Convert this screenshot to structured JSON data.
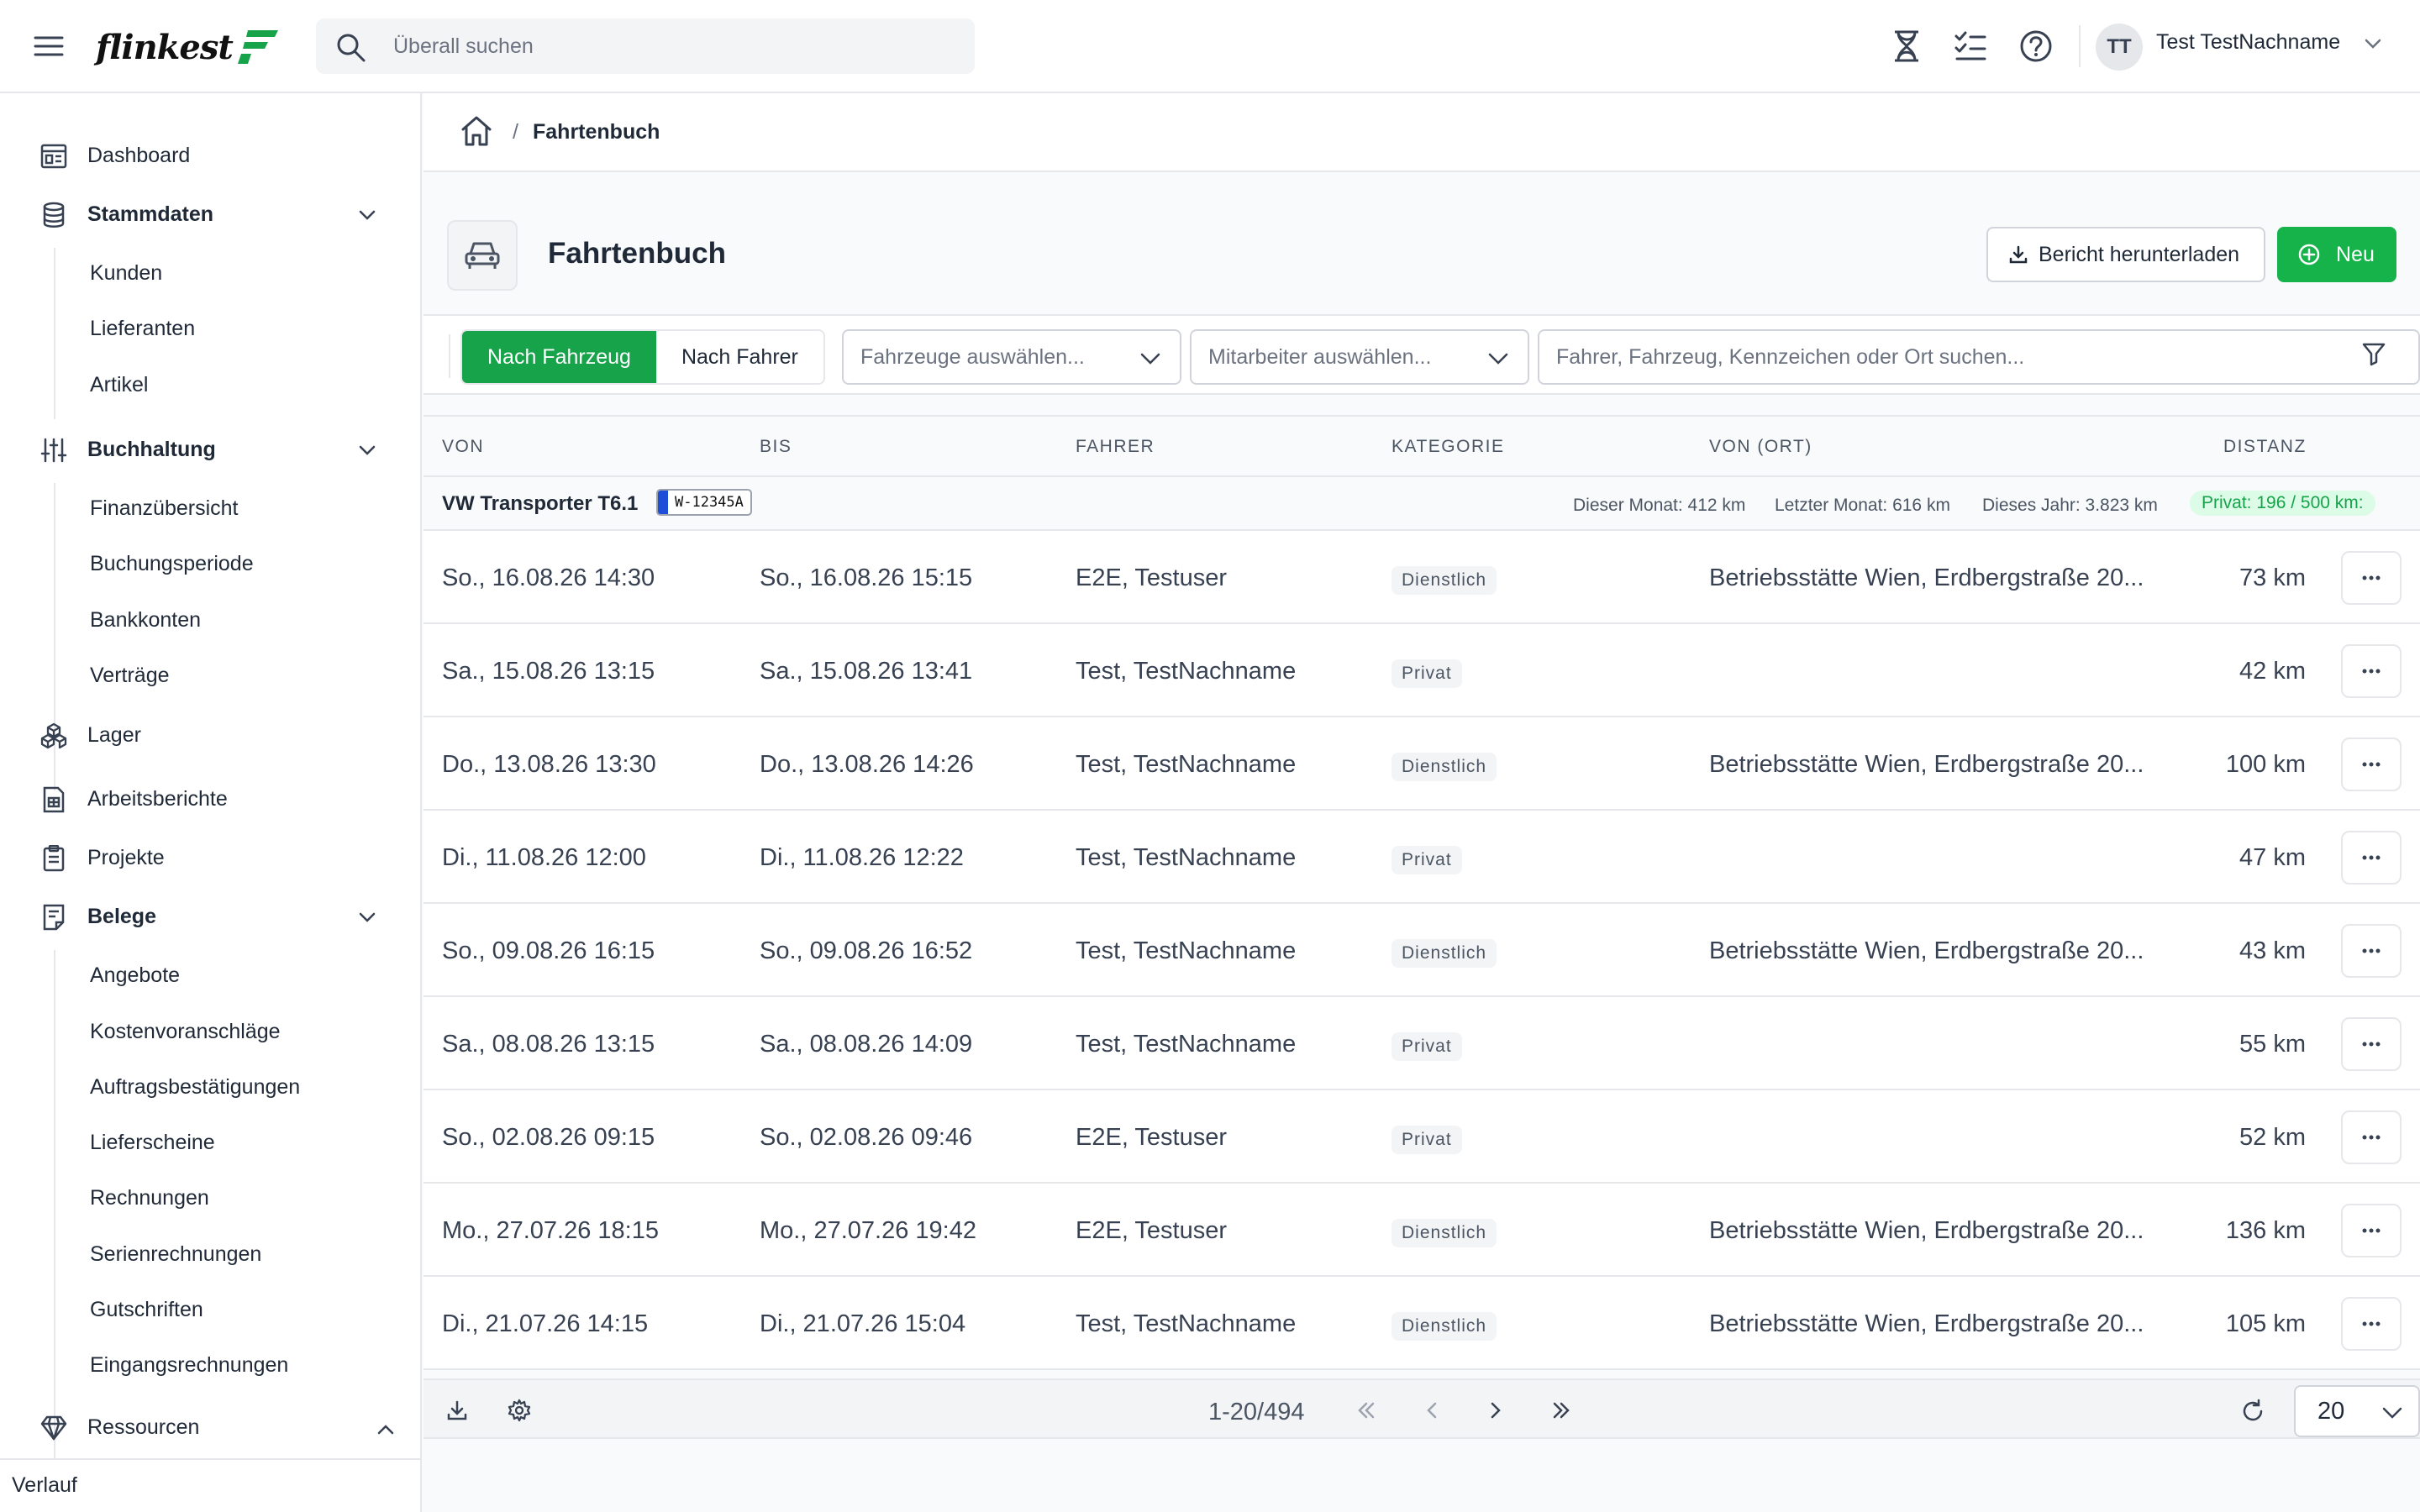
{
  "app": {
    "logo_text": "flinkest",
    "brand_color": "#16a34a"
  },
  "search": {
    "placeholder": "Überall suchen"
  },
  "user": {
    "initials": "TT",
    "name": "Test TestNachname"
  },
  "sidebar": {
    "items": [
      {
        "label": "Dashboard",
        "icon": "dashboard-icon"
      },
      {
        "label": "Stammdaten",
        "icon": "database-icon",
        "sub": [
          "Kunden",
          "Lieferanten",
          "Artikel"
        ]
      },
      {
        "label": "Buchhaltung",
        "icon": "sliders-icon",
        "sub": [
          "Finanzübersicht",
          "Buchungsperiode",
          "Bankkonten",
          "Verträge"
        ]
      },
      {
        "label": "Lager",
        "icon": "boxes-icon"
      },
      {
        "label": "Arbeitsberichte",
        "icon": "report-icon"
      },
      {
        "label": "Projekte",
        "icon": "clipboard-icon"
      },
      {
        "label": "Belege",
        "icon": "receipt-icon",
        "sub": [
          "Angebote",
          "Kostenvoranschläge",
          "Auftragsbestätigungen",
          "Lieferscheine",
          "Rechnungen",
          "Serienrechnungen",
          "Gutschriften",
          "Eingangsrechnungen"
        ]
      },
      {
        "label": "Ressourcen",
        "icon": "diamond-icon"
      }
    ],
    "footer": "Verlauf"
  },
  "breadcrumb": {
    "separator": "/",
    "current": "Fahrtenbuch"
  },
  "page": {
    "title": "Fahrtenbuch",
    "report_button": "Bericht herunterladen",
    "new_button": "Neu"
  },
  "filters": {
    "tab_vehicle": "Nach Fahrzeug",
    "tab_driver": "Nach Fahrer",
    "vehicle_select": "Fahrzeuge auswählen...",
    "employee_select": "Mitarbeiter auswählen...",
    "search_placeholder": "Fahrer, Fahrzeug, Kennzeichen oder Ort suchen..."
  },
  "table": {
    "headers": {
      "von": "VON",
      "bis": "BIS",
      "fahrer": "FAHRER",
      "kategorie": "KATEGORIE",
      "von_ort": "VON (ORT)",
      "distanz": "DISTANZ"
    },
    "group": {
      "vehicle": "VW Transporter T6.1",
      "plate": "W-12345A",
      "this_month": "Dieser Monat: 412 km",
      "last_month": "Letzter Monat: 616 km",
      "this_year": "Dieses Jahr: 3.823 km",
      "private": "Privat: 196 / 500 km:"
    },
    "rows": [
      {
        "von": "So., 16.08.26 14:30",
        "bis": "So., 16.08.26 15:15",
        "fahrer": "E2E, Testuser",
        "kategorie": "Dienstlich",
        "ort": "Betriebsstätte Wien, Erdbergstraße 20...",
        "distanz": "73 km"
      },
      {
        "von": "Sa., 15.08.26 13:15",
        "bis": "Sa., 15.08.26 13:41",
        "fahrer": "Test, TestNachname",
        "kategorie": "Privat",
        "ort": "",
        "distanz": "42 km"
      },
      {
        "von": "Do., 13.08.26 13:30",
        "bis": "Do., 13.08.26 14:26",
        "fahrer": "Test, TestNachname",
        "kategorie": "Dienstlich",
        "ort": "Betriebsstätte Wien, Erdbergstraße 20...",
        "distanz": "100 km"
      },
      {
        "von": "Di., 11.08.26 12:00",
        "bis": "Di., 11.08.26 12:22",
        "fahrer": "Test, TestNachname",
        "kategorie": "Privat",
        "ort": "",
        "distanz": "47 km"
      },
      {
        "von": "So., 09.08.26 16:15",
        "bis": "So., 09.08.26 16:52",
        "fahrer": "Test, TestNachname",
        "kategorie": "Dienstlich",
        "ort": "Betriebsstätte Wien, Erdbergstraße 20...",
        "distanz": "43 km"
      },
      {
        "von": "Sa., 08.08.26 13:15",
        "bis": "Sa., 08.08.26 14:09",
        "fahrer": "Test, TestNachname",
        "kategorie": "Privat",
        "ort": "",
        "distanz": "55 km"
      },
      {
        "von": "So., 02.08.26 09:15",
        "bis": "So., 02.08.26 09:46",
        "fahrer": "E2E, Testuser",
        "kategorie": "Privat",
        "ort": "",
        "distanz": "52 km"
      },
      {
        "von": "Mo., 27.07.26 18:15",
        "bis": "Mo., 27.07.26 19:42",
        "fahrer": "E2E, Testuser",
        "kategorie": "Dienstlich",
        "ort": "Betriebsstätte Wien, Erdbergstraße 20...",
        "distanz": "136 km"
      },
      {
        "von": "Di., 21.07.26 14:15",
        "bis": "Di., 21.07.26 15:04",
        "fahrer": "Test, TestNachname",
        "kategorie": "Dienstlich",
        "ort": "Betriebsstätte Wien, Erdbergstraße 20...",
        "distanz": "105 km"
      }
    ]
  },
  "pagination": {
    "info": "1-20/494",
    "page_size": "20"
  }
}
